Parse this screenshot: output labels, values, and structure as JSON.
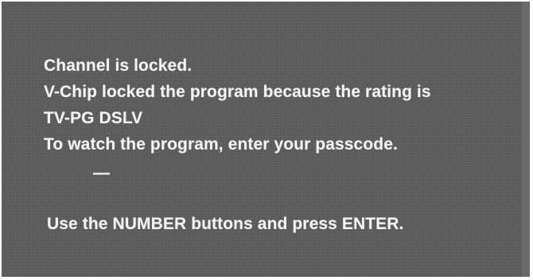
{
  "osd": {
    "line_channel_locked": "Channel is locked.",
    "line_vchip": "V-Chip locked the program because the rating is",
    "line_rating": "TV-PG DSLV",
    "line_instruction": "To watch the program, enter your passcode.",
    "passcode_field": "—",
    "line_help": "Use the NUMBER buttons and press ENTER."
  }
}
